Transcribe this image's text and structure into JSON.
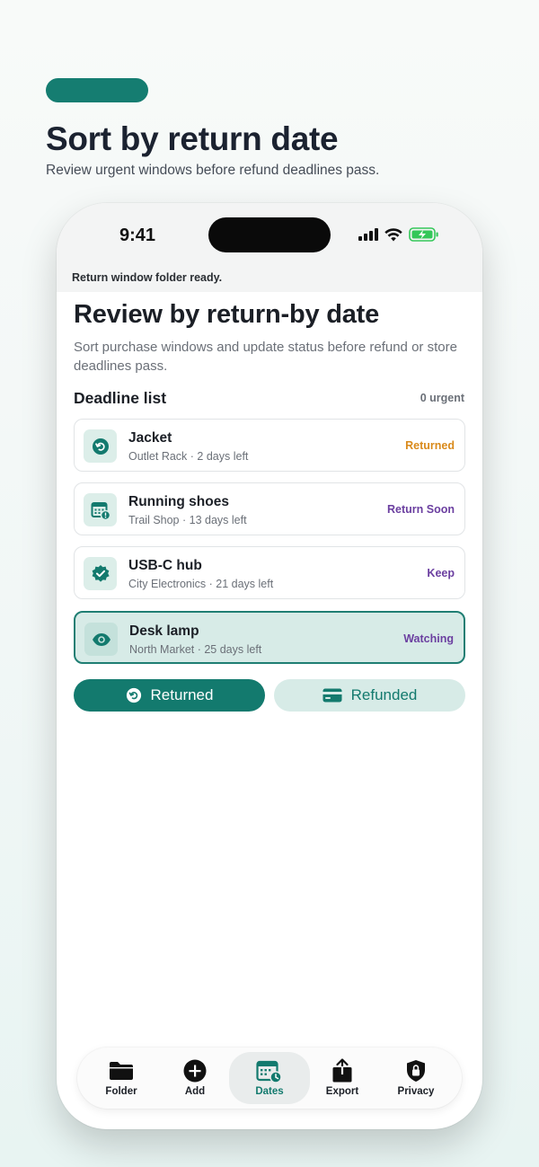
{
  "promo": {
    "title": "Sort by return date",
    "subtitle": "Review urgent windows before refund deadlines pass."
  },
  "status_bar": {
    "time": "9:41"
  },
  "banner": "Return window folder ready.",
  "screen": {
    "title": "Review by return-by date",
    "description": "Sort purchase windows and update status before refund or store deadlines pass.",
    "list_heading": "Deadline list",
    "urgent_count": "0 urgent"
  },
  "items": [
    {
      "name": "Jacket",
      "meta": "Outlet Rack · 2 days left",
      "status": "Returned",
      "icon": "returned-icon",
      "status_color": "#d98a1b"
    },
    {
      "name": "Running shoes",
      "meta": "Trail Shop · 13 days left",
      "status": "Return Soon",
      "icon": "calendar-alert-icon",
      "status_color": "#6b3fa0"
    },
    {
      "name": "USB-C hub",
      "meta": "City Electronics · 21 days left",
      "status": "Keep",
      "icon": "verified-badge-icon",
      "status_color": "#6b3fa0"
    },
    {
      "name": "Desk lamp",
      "meta": "North Market · 25 days left",
      "status": "Watching",
      "icon": "eye-icon",
      "status_color": "#6b3fa0",
      "selected": true
    }
  ],
  "actions": {
    "returned_label": "Returned",
    "refunded_label": "Refunded"
  },
  "tabs": [
    {
      "label": "Folder",
      "icon": "folder-icon"
    },
    {
      "label": "Add",
      "icon": "add-icon"
    },
    {
      "label": "Dates",
      "icon": "calendar-icon",
      "active": true
    },
    {
      "label": "Export",
      "icon": "share-icon"
    },
    {
      "label": "Privacy",
      "icon": "lock-shield-icon"
    }
  ],
  "colors": {
    "accent": "#137a6e",
    "accent_light": "#d7ebe7",
    "returned": "#d98a1b",
    "status_purple": "#6b3fa0"
  }
}
